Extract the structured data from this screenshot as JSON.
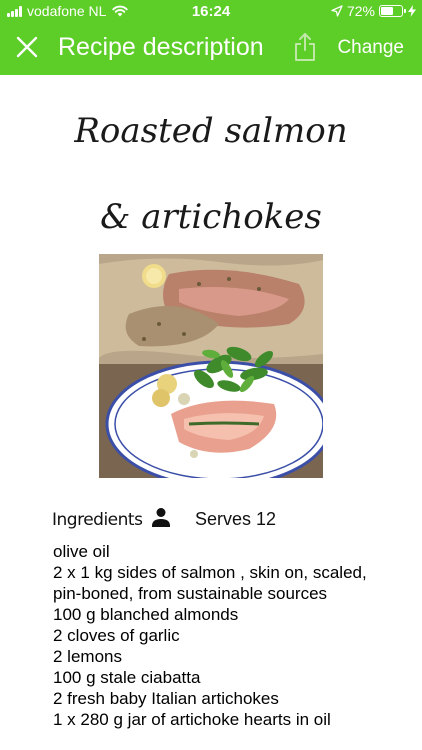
{
  "status_bar": {
    "carrier": "vodafone NL",
    "time": "16:24",
    "battery_percent": "72%",
    "battery_level": 0.72,
    "icons": [
      "signal-icon",
      "wifi-icon",
      "location-icon",
      "battery-icon",
      "charging-icon"
    ]
  },
  "nav": {
    "title": "Recipe description",
    "change_label": "Change",
    "icons": [
      "close-icon",
      "share-icon"
    ]
  },
  "colors": {
    "header_green": "#5dcd27",
    "text": "#000000",
    "background": "#ffffff"
  },
  "recipe": {
    "title_line1": "Roasted salmon",
    "title_line2": "& artichokes",
    "ingredients_label": "Ingredients",
    "serves": "Serves 12",
    "photo": "roasted-salmon-photo",
    "ingredients": [
      "olive oil",
      "2 x 1 kg sides of salmon , skin on, scaled, pin-boned, from sustainable sources",
      "100 g blanched almonds",
      "2 cloves of garlic",
      "2 lemons",
      "100 g stale ciabatta",
      "2 fresh baby Italian artichokes",
      "1 x 280 g jar of artichoke hearts in oil"
    ]
  }
}
